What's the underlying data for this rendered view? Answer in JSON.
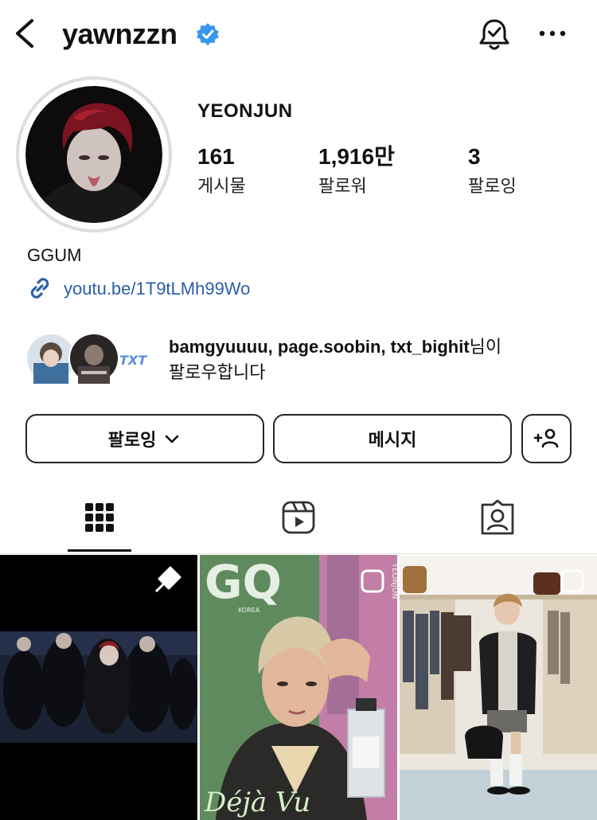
{
  "header": {
    "username": "yawnzzn",
    "icons": [
      "back-icon",
      "verified-badge-icon",
      "notification-bell-icon",
      "more-options-icon"
    ]
  },
  "profile": {
    "display_name": "YEONJUN",
    "stats": [
      {
        "value": "161",
        "label": "게시물"
      },
      {
        "value": "1,916만",
        "label": "팔로워"
      },
      {
        "value": "3",
        "label": "팔로잉"
      }
    ],
    "bio": "GGUM",
    "link": "youtu.be/1T9tLMh99Wo"
  },
  "mutual": {
    "names": "bamgyuuuu, page.soobin, txt_bighit",
    "suffix": "님이",
    "line2": "팔로우합니다",
    "third_avatar_text": "TXT"
  },
  "buttons": {
    "follow": "팔로잉",
    "message": "메시지"
  },
  "tabs": [
    "posts-grid-icon",
    "reels-icon",
    "tagged-icon"
  ],
  "grid": {
    "tile2_masthead": "GQ",
    "tile2_sub": "KOREA",
    "tile2_side": "YEONJUN",
    "tile2_caption": "Déjà Vu"
  },
  "colors": {
    "verified": "#3897f0",
    "link": "#2b5ea8",
    "border": "#262626"
  }
}
